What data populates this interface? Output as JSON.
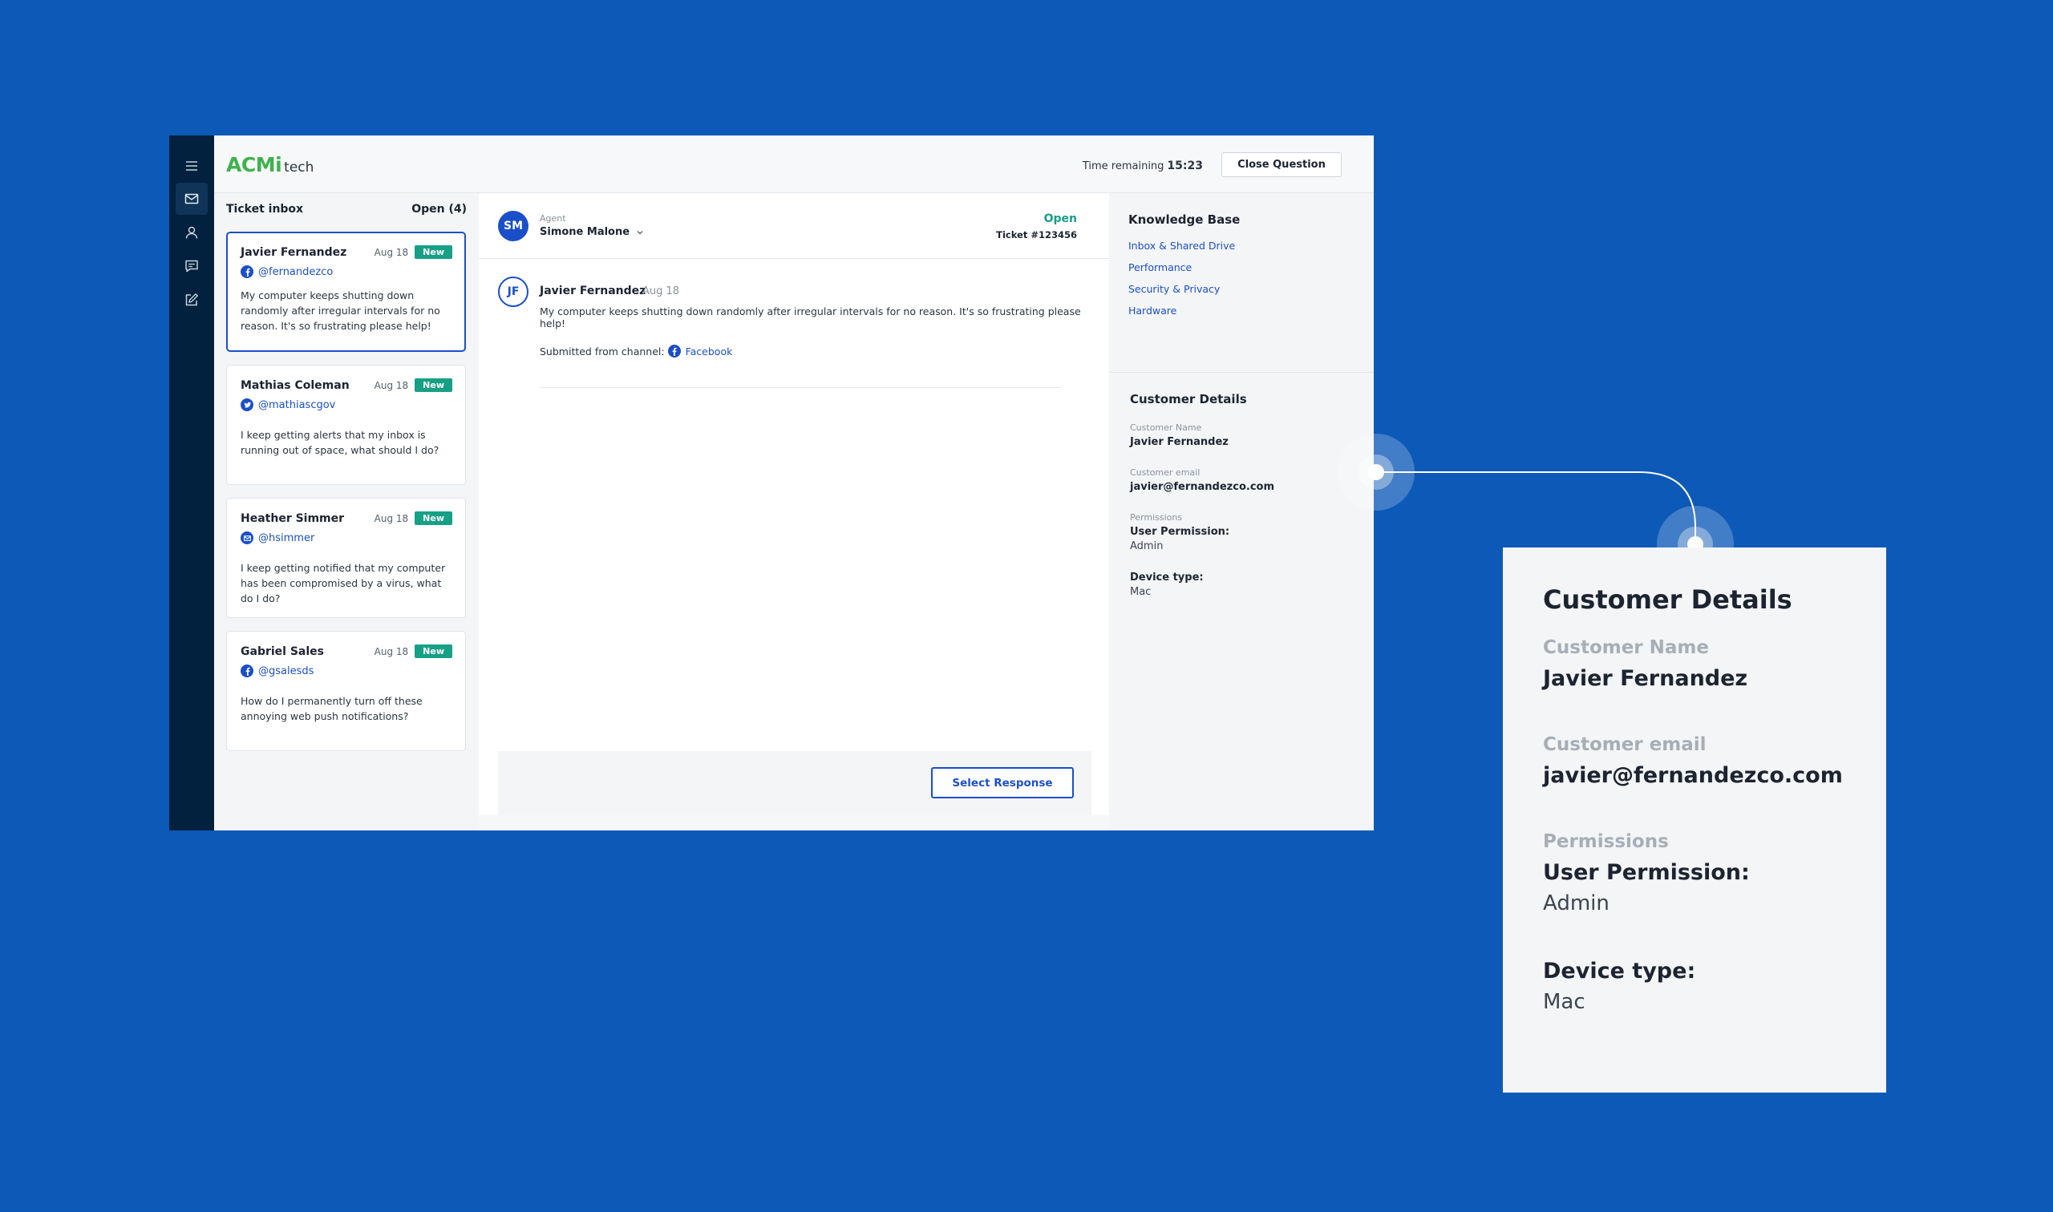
{
  "header": {
    "logo_primary": "ACMi",
    "logo_secondary": "tech",
    "timer_label": "Time remaining",
    "timer_value": "15:23",
    "close_label": "Close Question"
  },
  "rail": {
    "icons": [
      "menu-icon",
      "inbox-icon",
      "user-icon",
      "chat-icon",
      "edit-icon"
    ],
    "active": "inbox-icon"
  },
  "inbox": {
    "title": "Ticket inbox",
    "count_label": "Open (4)",
    "tickets": [
      {
        "name": "Javier Fernandez",
        "date": "Aug 18",
        "badge": "New",
        "channel": "facebook",
        "handle": "@fernandezco",
        "message": "My computer keeps shutting down randomly after irregular intervals for no reason. It's so frustrating please help!"
      },
      {
        "name": "Mathias Coleman",
        "date": "Aug 18",
        "badge": "New",
        "channel": "twitter",
        "handle": "@mathiascgov",
        "message": "I keep getting alerts that my inbox is running out of space, what should I do?"
      },
      {
        "name": "Heather Simmer",
        "date": "Aug 18",
        "badge": "New",
        "channel": "email",
        "handle": "@hsimmer",
        "message": "I keep getting notified that my computer has been compromised by a virus, what do I do?"
      },
      {
        "name": "Gabriel Sales",
        "date": "Aug 18",
        "badge": "New",
        "channel": "facebook",
        "handle": "@gsalesds",
        "message": "How do I permanently turn off these annoying web push notifications?"
      }
    ]
  },
  "conversation": {
    "agent_initials": "SM",
    "agent_label": "Agent",
    "agent_name": "Simone Malone",
    "status": "Open",
    "ticket_number": "Ticket #123456",
    "customer_initials": "JF",
    "customer_name": "Javier Fernandez",
    "message_date": "Aug 18",
    "message": "My computer keeps shutting down randomly after irregular intervals for no reason. It's so frustrating please help!",
    "submitted_label": "Submitted from channel:",
    "channel_name": "Facebook",
    "response_button": "Select Response"
  },
  "knowledge_base": {
    "title": "Knowledge Base",
    "links": [
      "Inbox & Shared Drive",
      "Performance",
      "Security & Privacy",
      "Hardware"
    ]
  },
  "customer_details": {
    "title": "Customer Details",
    "name_label": "Customer Name",
    "name": "Javier Fernandez",
    "email_label": "Customer email",
    "email": "javier@fernandezco.com",
    "permissions_label": "Permissions",
    "permission_heading": "User Permission:",
    "permission_value": "Admin",
    "device_heading": "Device type:",
    "device_value": "Mac"
  },
  "colors": {
    "background": "#0d59b8",
    "rail": "#02213f",
    "accent": "#1a4fc9",
    "logo": "#3fb14c",
    "badge": "#16a085"
  }
}
